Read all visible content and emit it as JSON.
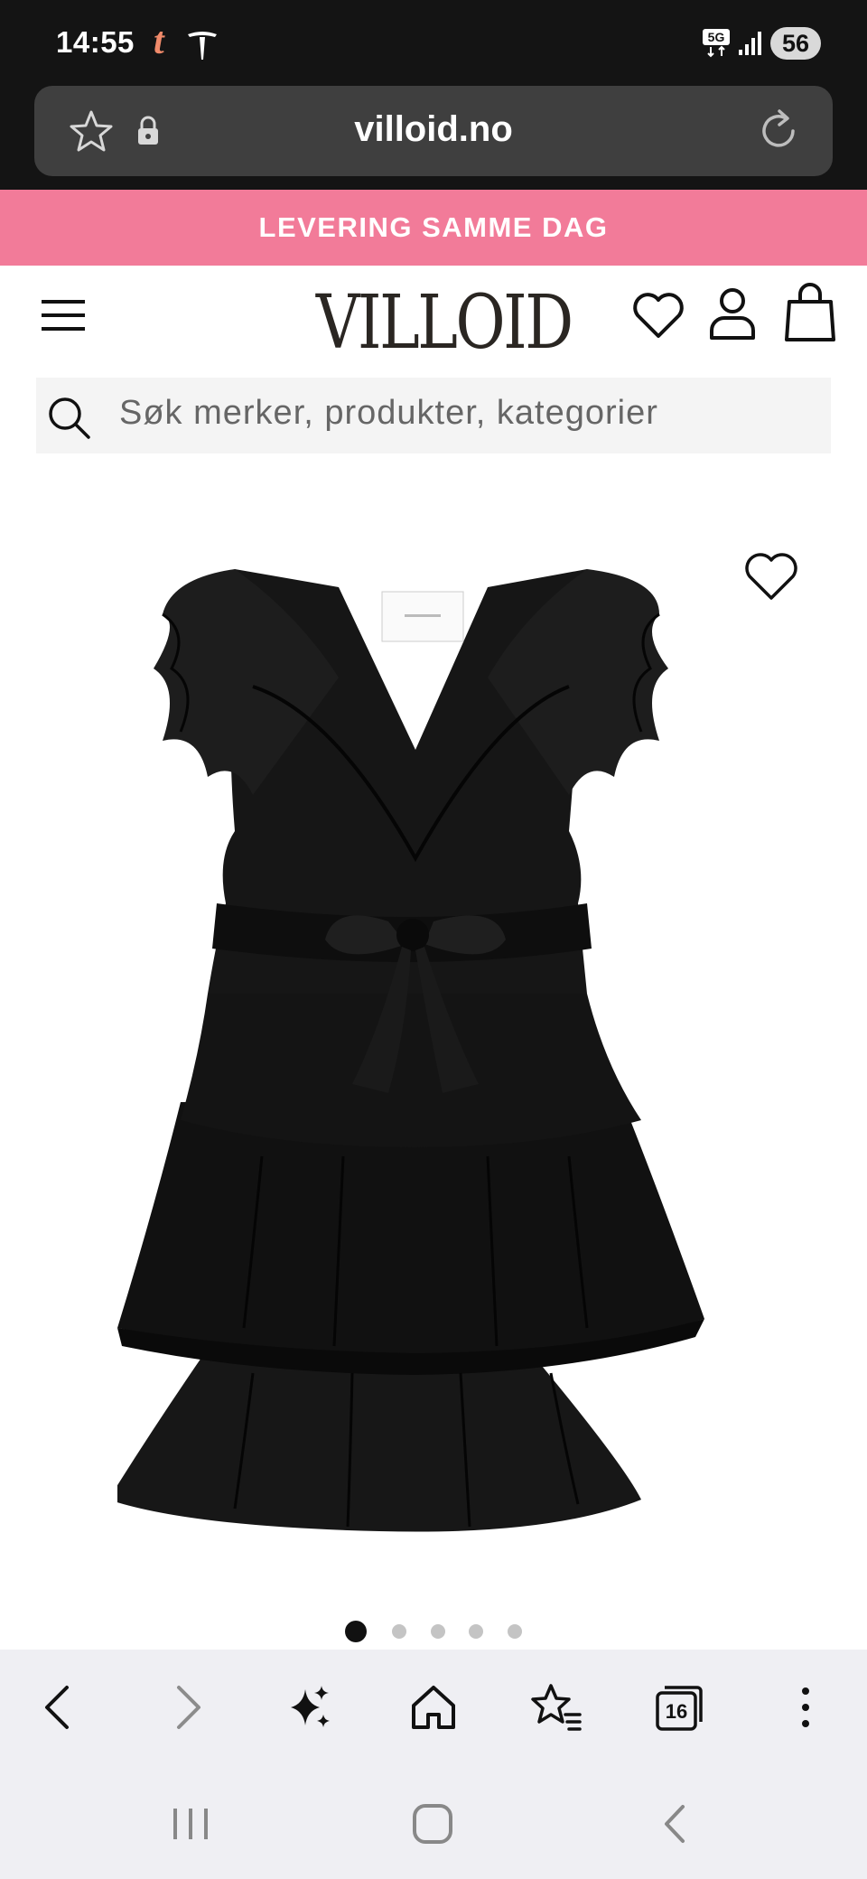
{
  "status_bar": {
    "time": "14:55",
    "carrier_glyph": "t",
    "network": "5G",
    "battery": "56"
  },
  "browser": {
    "url": "villoid.no"
  },
  "promo": {
    "text": "LEVERING SAMME DAG"
  },
  "header": {
    "logo": "VILLOID",
    "icons": [
      "menu-icon",
      "heart-icon",
      "user-icon",
      "shopping-bag-icon"
    ]
  },
  "search": {
    "placeholder": "Søk merker, produkter, kategorier"
  },
  "product": {
    "image_label": "black ruffled tiered mini dress",
    "carousel": {
      "total": 5,
      "active_index": 0
    }
  },
  "toolbar": {
    "tab_count": "16",
    "icons": [
      "back-icon",
      "forward-icon",
      "sparkle-icon",
      "home-icon",
      "bookmarks-icon",
      "tabs-icon",
      "more-icon"
    ]
  },
  "nav_bar": {
    "icons": [
      "recents-icon",
      "home-circle-icon",
      "system-back-icon"
    ]
  },
  "colors": {
    "promo_bg": "#f27b99",
    "status_bg": "#141414",
    "url_bar_bg": "#3f3f3f",
    "toolbar_bg": "#efeff3"
  }
}
